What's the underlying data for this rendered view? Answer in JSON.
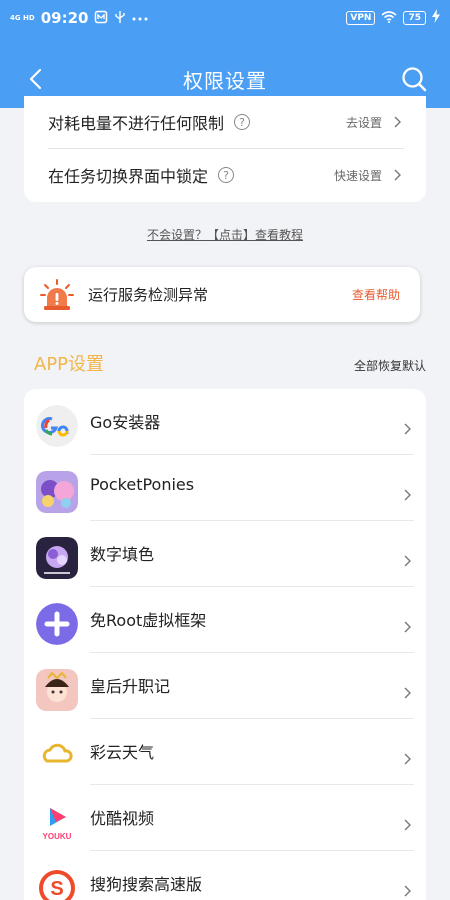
{
  "status_bar": {
    "network": "4G HD",
    "time": "09:20",
    "extra_icons": [
      "notification-icon",
      "usb-icon",
      "more-icon"
    ],
    "vpn": "VPN",
    "battery": "75"
  },
  "nav": {
    "title": "权限设置"
  },
  "permissions": [
    {
      "label": "对耗电量不进行任何限制",
      "info": "?",
      "action": "去设置"
    },
    {
      "label": "在任务切换界面中锁定",
      "info": "?",
      "action": "快速设置"
    }
  ],
  "tutorial_link": "不会设置？【点击】查看教程",
  "alert": {
    "text": "运行服务检测异常",
    "help": "查看帮助",
    "accent": "#e85b2d"
  },
  "app_section": {
    "title": "APP设置",
    "reset": "全部恢复默认",
    "title_color": "#f1b64a"
  },
  "apps": [
    {
      "name": "Go安装器",
      "icon": "go-installer-icon"
    },
    {
      "name": "PocketPonies",
      "icon": "pocketponies-icon"
    },
    {
      "name": "数字填色",
      "icon": "color-by-number-icon"
    },
    {
      "name": "免Root虚拟框架",
      "icon": "virtual-framework-icon"
    },
    {
      "name": "皇后升职记",
      "icon": "queen-game-icon"
    },
    {
      "name": "彩云天气",
      "icon": "caiyun-weather-icon"
    },
    {
      "name": "优酷视频",
      "icon": "youku-icon"
    },
    {
      "name": "搜狗搜索高速版",
      "icon": "sogou-search-icon"
    }
  ],
  "colors": {
    "header": "#4a9ef3",
    "background": "#f2f3f7"
  }
}
